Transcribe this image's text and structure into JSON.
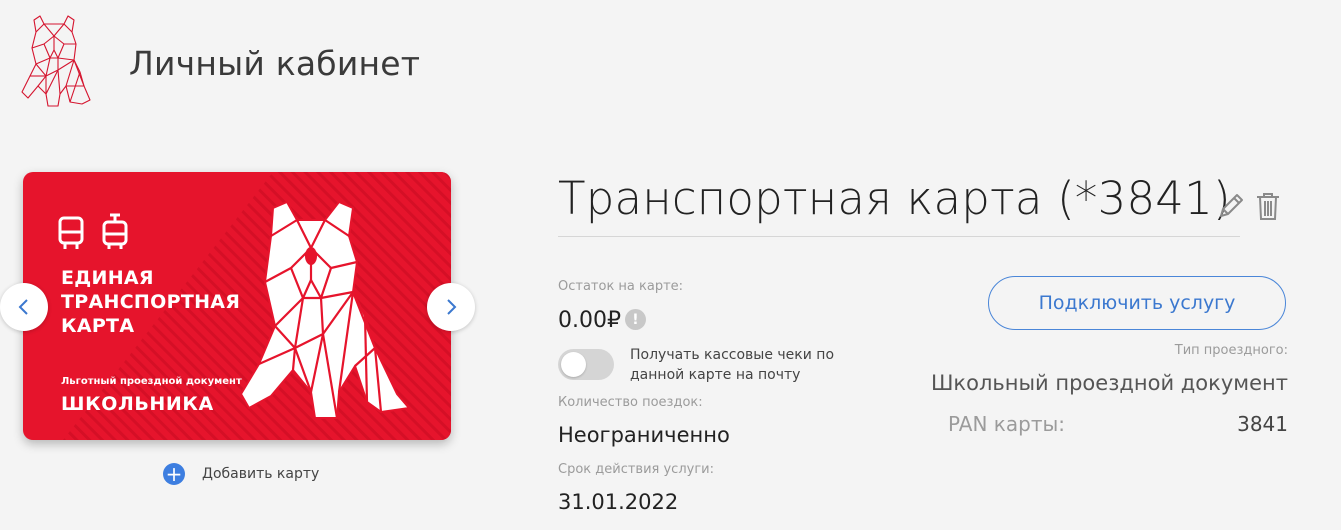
{
  "header": {
    "title": "Личный кабинет"
  },
  "colors": {
    "brand_red": "#e6142c",
    "accent_blue": "#3b78cf"
  },
  "card": {
    "title_lines": [
      "ЕДИНАЯ",
      "ТРАНСПОРТНАЯ",
      "КАРТА"
    ],
    "subtitle": "Льготный проездной документ",
    "category": "ШКОЛЬНИКА"
  },
  "carousel": {
    "prev_icon": "chevron-left-icon",
    "next_icon": "chevron-right-icon"
  },
  "add_card": {
    "label": "Добавить карту"
  },
  "details": {
    "card_name": "Транспортная карта (*3841)",
    "balance_label": "Остаток на карте:",
    "balance_value": "0.00₽",
    "info_symbol": "!",
    "receipts_label": "Получать кассовые чеки по данной карте на почту",
    "receipts_enabled": false,
    "trips_label": "Количество поездок:",
    "trips_value": "Неограниченно",
    "validity_label": "Срок действия услуги:",
    "validity_value": "31.01.2022"
  },
  "service": {
    "connect_button": "Подключить услугу",
    "ticket_type_label": "Тип проездного:",
    "ticket_type_value": "Школьный проездной документ",
    "pan_label": "PAN карты:",
    "pan_value": "3841"
  }
}
